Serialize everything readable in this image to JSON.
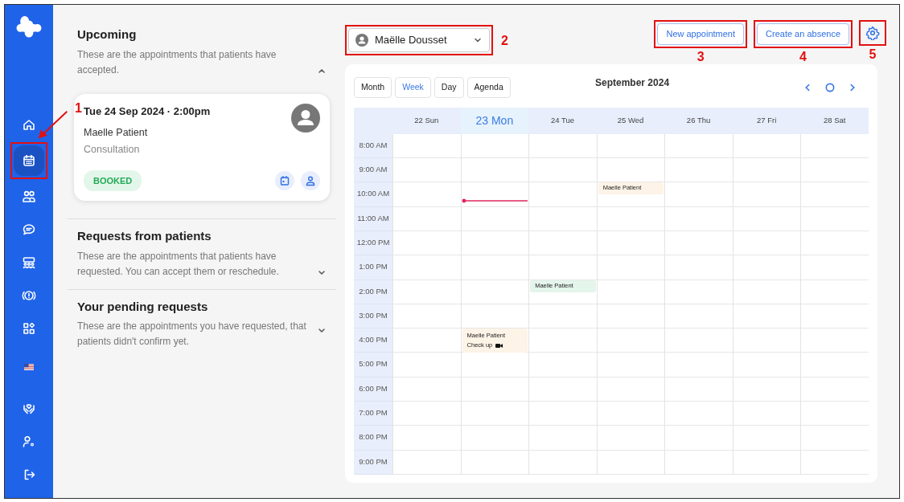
{
  "sidebar": {
    "items": [
      {
        "selected": false
      },
      {
        "selected": true,
        "callout": "1"
      },
      {
        "selected": false
      },
      {
        "selected": false
      },
      {
        "selected": false
      },
      {
        "selected": false
      },
      {
        "selected": false
      }
    ],
    "footer_items": [
      {
        "selected": false
      },
      {
        "selected": false
      },
      {
        "selected": false
      },
      {
        "selected": false
      }
    ]
  },
  "sections": [
    {
      "title": "Upcoming",
      "description": "These are the appointments that patients have accepted.",
      "expanded": true,
      "appointments": [
        {
          "datetime": "Tue 24 Sep 2024 · 2:00pm",
          "patient": "Maelle Patient",
          "type": "Consultation",
          "status": "BOOKED"
        }
      ]
    },
    {
      "title": "Requests from patients",
      "description": "These are the appointments that patients have requested. You can accept them or reschedule.",
      "expanded": false
    },
    {
      "title": "Your pending requests",
      "description": "These are the appointments you have requested, that patients didn't confirm yet.",
      "expanded": false
    }
  ],
  "doctor_select": {
    "value": "Maëlle Dousset",
    "callout": "2"
  },
  "buttons": [
    {
      "label": "New appointment",
      "callout": "3"
    },
    {
      "label": "Create an absence",
      "callout": "4"
    }
  ],
  "settings_button": {
    "callout": "5"
  },
  "calendar": {
    "views": [
      {
        "label": "Month",
        "selected": false
      },
      {
        "label": "Week",
        "selected": true
      },
      {
        "label": "Day",
        "selected": false
      },
      {
        "label": "Agenda",
        "selected": false
      }
    ],
    "title": "September 2024",
    "days": [
      {
        "label": "22 Sun",
        "today": false
      },
      {
        "label": "23 Mon",
        "today": true
      },
      {
        "label": "24 Tue",
        "today": false
      },
      {
        "label": "25 Wed",
        "today": false
      },
      {
        "label": "26 Thu",
        "today": false
      },
      {
        "label": "27 Fri",
        "today": false
      },
      {
        "label": "28 Sat",
        "today": false
      }
    ],
    "rows": [
      {
        "time": "8:00 AM",
        "cells": [
          null,
          null,
          null,
          null,
          null,
          null,
          null
        ]
      },
      {
        "time": "9:00 AM",
        "cells": [
          null,
          null,
          null,
          null,
          null,
          null,
          null
        ]
      },
      {
        "time": "10:00 AM",
        "cells": [
          null,
          {
            "now_marker": true
          },
          null,
          {
            "event": {
              "title": "Maelle Patient",
              "color": "#fdf3e7"
            }
          },
          null,
          null,
          null
        ]
      },
      {
        "time": "11:00 AM",
        "cells": [
          null,
          null,
          null,
          null,
          null,
          null,
          null
        ]
      },
      {
        "time": "12:00 PM",
        "cells": [
          null,
          null,
          null,
          null,
          null,
          null,
          null
        ]
      },
      {
        "time": "1:00 PM",
        "cells": [
          null,
          null,
          null,
          null,
          null,
          null,
          null
        ]
      },
      {
        "time": "2:00 PM",
        "cells": [
          null,
          null,
          {
            "event": {
              "title": "Maelle Patient",
              "color": "#e4f5eb"
            }
          },
          null,
          null,
          null,
          null
        ]
      },
      {
        "time": "3:00 PM",
        "cells": [
          null,
          null,
          null,
          null,
          null,
          null,
          null
        ]
      },
      {
        "time": "4:00 PM",
        "cells": [
          null,
          {
            "event": {
              "title": "Maelle Patient",
              "detail": "Check up",
              "video": true,
              "color": "#fdf3e7"
            }
          },
          null,
          null,
          null,
          null,
          null
        ]
      },
      {
        "time": "5:00 PM",
        "cells": [
          null,
          null,
          null,
          null,
          null,
          null,
          null
        ]
      },
      {
        "time": "6:00 PM",
        "cells": [
          null,
          null,
          null,
          null,
          null,
          null,
          null
        ]
      },
      {
        "time": "7:00 PM",
        "cells": [
          null,
          null,
          null,
          null,
          null,
          null,
          null
        ]
      },
      {
        "time": "8:00 PM",
        "cells": [
          null,
          null,
          null,
          null,
          null,
          null,
          null
        ]
      },
      {
        "time": "9:00 PM",
        "cells": [
          null,
          null,
          null,
          null,
          null,
          null,
          null
        ]
      }
    ]
  }
}
